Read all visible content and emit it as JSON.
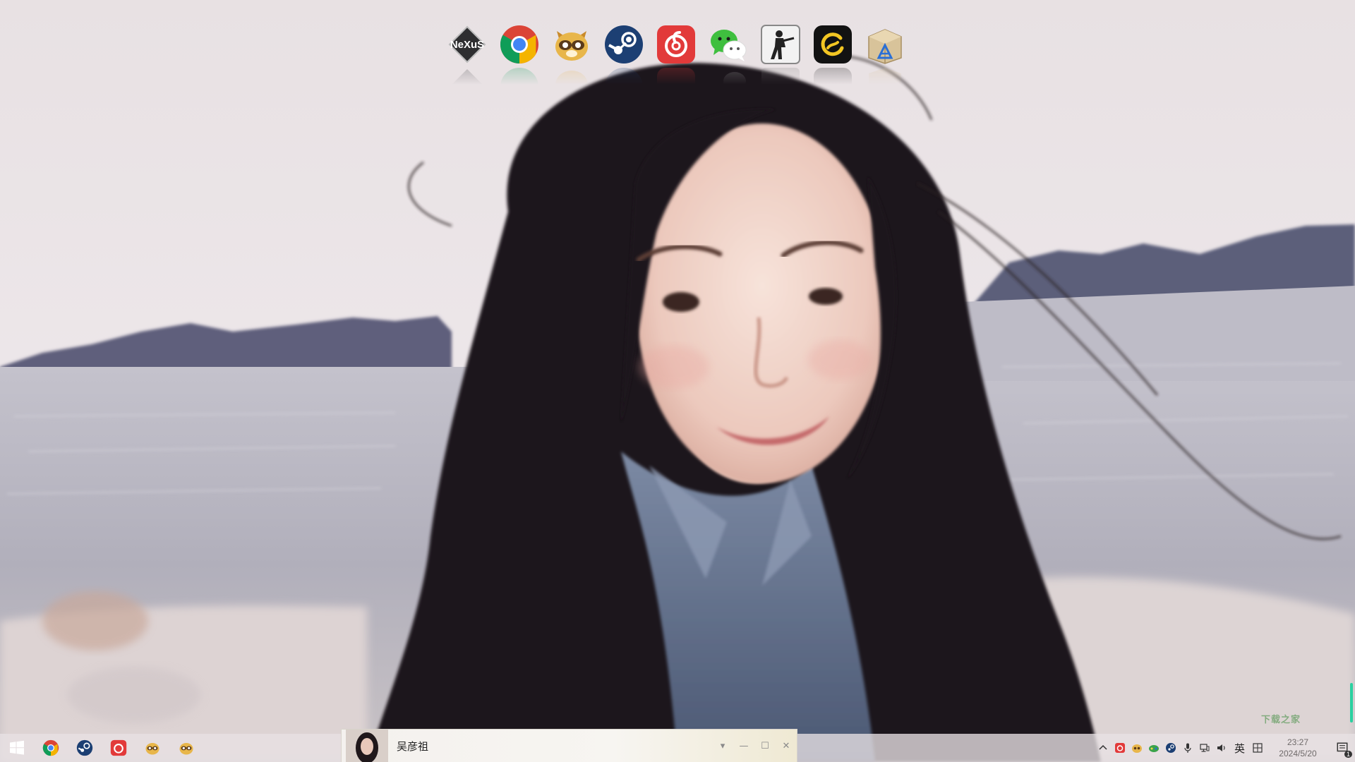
{
  "dock": {
    "items": [
      {
        "name": "Nexus",
        "icon": "nexus-icon"
      },
      {
        "name": "Google Chrome",
        "icon": "chrome-icon"
      },
      {
        "name": "Raccoon app",
        "icon": "raccoon-icon"
      },
      {
        "name": "Steam",
        "icon": "steam-icon"
      },
      {
        "name": "NetEase Cloud Music",
        "icon": "netease-music-icon"
      },
      {
        "name": "WeChat",
        "icon": "wechat-icon"
      },
      {
        "name": "Counter-Strike",
        "icon": "counter-strike-icon"
      },
      {
        "name": "Game app",
        "icon": "game-app-icon"
      },
      {
        "name": "App installer",
        "icon": "app-installer-icon"
      }
    ]
  },
  "taskbar": {
    "buttons": [
      "windows-start-icon",
      "chrome-icon",
      "steam-icon",
      "netease-music-icon",
      "raccoon-icon",
      "raccoon-icon"
    ]
  },
  "player": {
    "song_title": "吴彦祖"
  },
  "tray": {
    "ime_label": "英",
    "time": "23:27",
    "date": "2024/5/20",
    "notification_count": "1"
  },
  "watermark": {
    "text": "下载之家"
  },
  "colors": {
    "sky": "#e9e3e4",
    "sea": "#b9b8c2",
    "mountain": "#5d5f7c",
    "hair": "#1c1518",
    "skin": "#f0d8cf",
    "denim": "#5d6b84",
    "taskbar": "#e8e2e4",
    "netease_red": "#e23a3a",
    "wechat_green": "#3fbf3f",
    "steam_blue": "#1c3f73"
  }
}
